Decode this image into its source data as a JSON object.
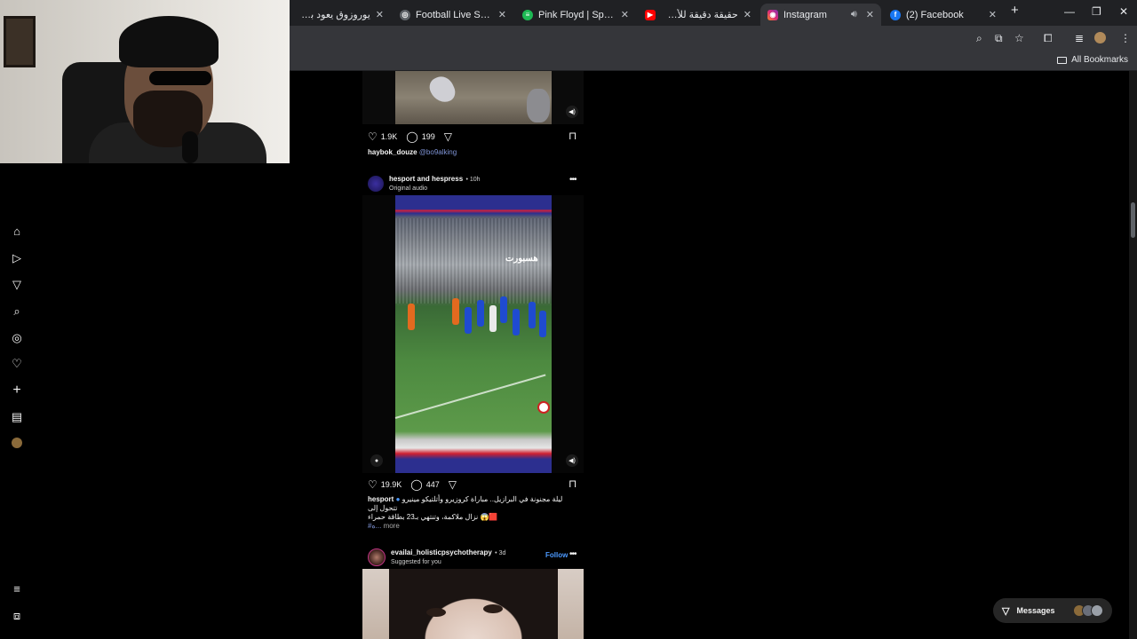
{
  "browser": {
    "tabs": [
      {
        "title": "يوروزوق يعود بقوة وضارب",
        "favicon_color": "#1a1a1a",
        "active": false
      },
      {
        "title": "Football Live Scores, Late",
        "favicon_color": "#5f6368",
        "active": false
      },
      {
        "title": "Pink Floyd | Spotify",
        "favicon_color": "#1db954",
        "active": false
      },
      {
        "title": "حقيقة دقيقة للأساطير سحر",
        "favicon_color": "#ff0000",
        "active": false
      },
      {
        "title": "Instagram",
        "favicon_color": "#e1306c",
        "active": true
      },
      {
        "title": "(2) Facebook",
        "favicon_color": "#1877f2",
        "active": false
      }
    ],
    "bookmarks_label": "All Bookmarks"
  },
  "feed": {
    "post1": {
      "likes": "1.9K",
      "comments": "199",
      "caption_user": "haybok_douze",
      "caption_mention": "@bo9alking"
    },
    "post2": {
      "user": "hesport and hespress",
      "time": "• 10h",
      "audio": "Original audio",
      "watermark": "هسبورت",
      "likes": "19.9K",
      "comments": "447",
      "caption_user": "hesport",
      "caption_line1": "ليلة مجنونة في البرازيل.. مباراة كروزيرو وأتلتيكو مينيرو تتحول إلى",
      "caption_line2": "نزال ملاكمة، وتنتهي بـ23 بطاقة حمراء 😱🟥",
      "hashtags": "#ه...",
      "more": "more"
    },
    "post3": {
      "user": "evailai_holisticpsychotherapy",
      "time": "• 3d",
      "sub": "Suggested for you",
      "follow": "Follow"
    }
  },
  "messages": {
    "label": "Messages"
  },
  "colors": {
    "background": "#000000",
    "link": "#7f94d6",
    "follow": "#4c9aff",
    "chrome_tabbar": "#202124",
    "chrome_toolbar": "#35363a"
  }
}
